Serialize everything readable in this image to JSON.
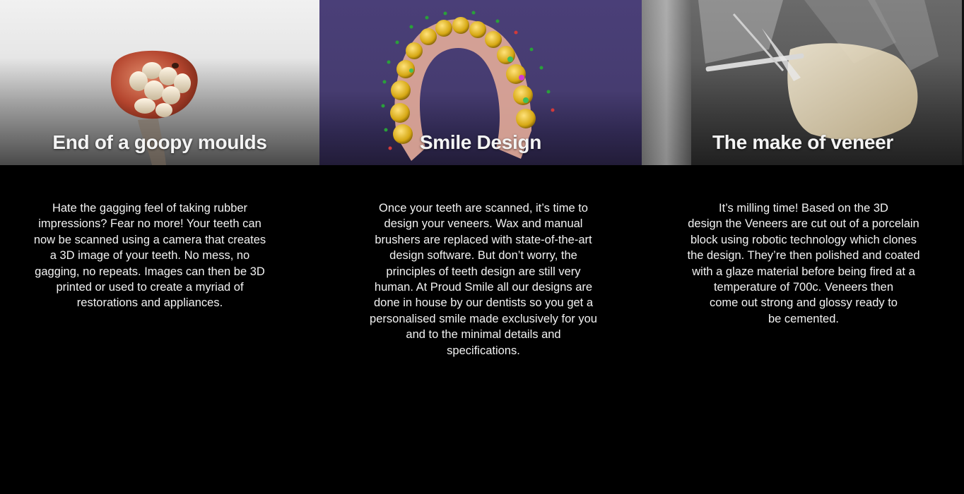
{
  "cards": [
    {
      "title": "End of a goopy moulds",
      "image": "3d-tooth-scan-image",
      "lines": [
        "Hate the gagging feel of taking rubber",
        "impressions? Fear no more! Your teeth can",
        "now be scanned using a camera that creates",
        "a 3D image of your teeth. No mess, no",
        "gagging, no repeats. Images can then be 3D",
        "printed or used to create a myriad of",
        "restorations and appliances."
      ]
    },
    {
      "title": "Smile Design",
      "image": "dental-arch-software-image",
      "lines": [
        "Once your teeth are scanned, it’s time to",
        "design your veneers. Wax and manual",
        "brushers are replaced with state-of-the-art",
        "design software. But don’t worry, the",
        "principles of teeth design are still very",
        "human. At Proud Smile all our designs are",
        "done in house by our dentists so you get a",
        "personalised smile made exclusively for you",
        "and to the minimal details and",
        "specifications."
      ]
    },
    {
      "title": "The make of veneer",
      "image": "milling-machine-image",
      "lines": [
        "It’s milling time! Based on the 3D",
        "design the Veneers are cut out of a porcelain",
        "block using robotic technology which clones",
        "the design. They’re then polished and coated",
        "with a glaze material before being fired at a",
        "temperature of 700c. Veneers then",
        "come out strong and glossy ready to",
        "be cemented."
      ]
    }
  ],
  "colors": {
    "page_background": "#000000",
    "card2_banner": "#4a3f78",
    "text": "#f2f2f2"
  }
}
